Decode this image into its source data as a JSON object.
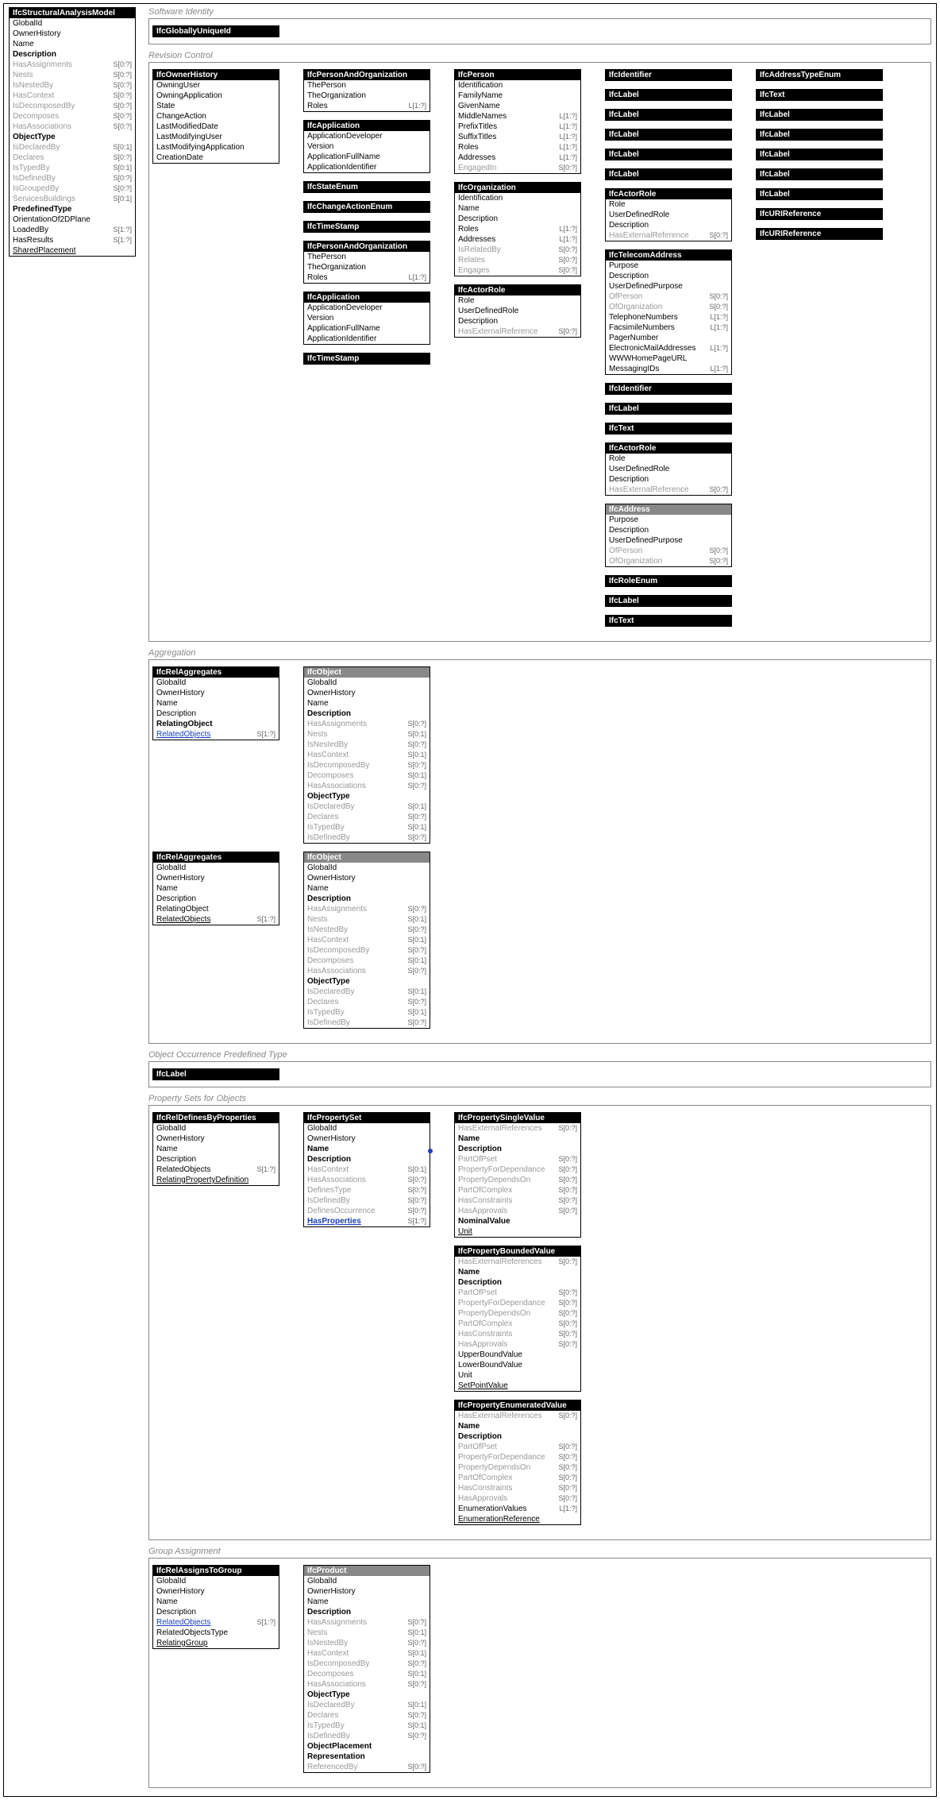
{
  "root": {
    "title": "IfcStructuralAnalysisModel",
    "attrs": [
      {
        "n": "GlobalId",
        "b": 0
      },
      {
        "n": "OwnerHistory",
        "b": 0
      },
      {
        "n": "Name",
        "b": 0
      },
      {
        "n": "Description",
        "b": 1
      },
      {
        "n": "HasAssignments",
        "c": "S[0:?]",
        "g": 1
      },
      {
        "n": "Nests",
        "c": "S[0:?]",
        "g": 1
      },
      {
        "n": "IsNestedBy",
        "c": "S[0:?]",
        "g": 1
      },
      {
        "n": "HasContext",
        "c": "S[0:?]",
        "g": 1
      },
      {
        "n": "IsDecomposedBy",
        "c": "S[0:?]",
        "g": 1
      },
      {
        "n": "Decomposes",
        "c": "S[0:?]",
        "g": 1
      },
      {
        "n": "HasAssociations",
        "c": "S[0:?]",
        "g": 1
      },
      {
        "n": "ObjectType",
        "b": 1
      },
      {
        "n": "IsDeclaredBy",
        "c": "S[0:1]",
        "g": 1
      },
      {
        "n": "Declares",
        "c": "S[0:?]",
        "g": 1
      },
      {
        "n": "IsTypedBy",
        "c": "S[0:1]",
        "g": 1
      },
      {
        "n": "IsDefinedBy",
        "c": "S[0:?]",
        "g": 1
      },
      {
        "n": "IsGroupedBy",
        "c": "S[0:?]",
        "g": 1
      },
      {
        "n": "ServicesBuildings",
        "c": "S[0:1]",
        "g": 1
      },
      {
        "n": "PredefinedType",
        "b": 1
      },
      {
        "n": "OrientationOf2DPlane",
        "b": 0
      },
      {
        "n": "LoadedBy",
        "c": "S[1:?]",
        "b": 0
      },
      {
        "n": "HasResults",
        "c": "S[1:?]",
        "b": 0
      },
      {
        "n": "SharedPlacement",
        "b": 0,
        "u": 1
      }
    ]
  },
  "sections": {
    "si": {
      "label": "Software Identity",
      "single": "IfcGloballyUniqueId"
    },
    "rc": {
      "label": "Revision Control"
    },
    "agg": {
      "label": "Aggregation"
    },
    "oopt": {
      "label": "Object Occurrence Predefined Type",
      "single": "IfcLabel"
    },
    "pso": {
      "label": "Property Sets for Objects"
    },
    "ga": {
      "label": "Group Assignment"
    }
  },
  "rc": {
    "ownerHistory": {
      "title": "IfcOwnerHistory",
      "attrs": [
        {
          "n": "OwningUser"
        },
        {
          "n": "OwningApplication"
        },
        {
          "n": "State"
        },
        {
          "n": "ChangeAction"
        },
        {
          "n": "LastModifiedDate"
        },
        {
          "n": "LastModifyingUser"
        },
        {
          "n": "LastModifyingApplication"
        },
        {
          "n": "CreationDate"
        }
      ]
    },
    "col2": [
      {
        "title": "IfcPersonAndOrganization",
        "attrs": [
          {
            "n": "ThePerson"
          },
          {
            "n": "TheOrganization"
          },
          {
            "n": "Roles",
            "c": "L[1:?]"
          }
        ]
      },
      {
        "title": "IfcApplication",
        "attrs": [
          {
            "n": "ApplicationDeveloper"
          },
          {
            "n": "Version"
          },
          {
            "n": "ApplicationFullName"
          },
          {
            "n": "ApplicationIdentifier"
          }
        ]
      },
      {
        "title": "IfcStateEnum",
        "attrs": []
      },
      {
        "title": "IfcChangeActionEnum",
        "attrs": []
      },
      {
        "title": "IfcTimeStamp",
        "attrs": []
      },
      {
        "title": "IfcPersonAndOrganization",
        "attrs": [
          {
            "n": "ThePerson"
          },
          {
            "n": "TheOrganization"
          },
          {
            "n": "Roles",
            "c": "L[1:?]"
          }
        ]
      },
      {
        "title": "IfcApplication",
        "attrs": [
          {
            "n": "ApplicationDeveloper"
          },
          {
            "n": "Version"
          },
          {
            "n": "ApplicationFullName"
          },
          {
            "n": "ApplicationIdentifier"
          }
        ]
      },
      {
        "title": "IfcTimeStamp",
        "attrs": []
      }
    ],
    "col3": [
      {
        "title": "IfcPerson",
        "attrs": [
          {
            "n": "Identification"
          },
          {
            "n": "FamilyName"
          },
          {
            "n": "GivenName"
          },
          {
            "n": "MiddleNames",
            "c": "L[1:?]"
          },
          {
            "n": "PrefixTitles",
            "c": "L[1:?]"
          },
          {
            "n": "SuffixTitles",
            "c": "L[1:?]"
          },
          {
            "n": "Roles",
            "c": "L[1:?]"
          },
          {
            "n": "Addresses",
            "c": "L[1:?]"
          },
          {
            "n": "EngagedIn",
            "c": "S[0:?]",
            "g": 1
          }
        ]
      },
      {
        "title": "IfcOrganization",
        "attrs": [
          {
            "n": "Identification"
          },
          {
            "n": "Name"
          },
          {
            "n": "Description"
          },
          {
            "n": "Roles",
            "c": "L[1:?]"
          },
          {
            "n": "Addresses",
            "c": "L[1:?]"
          },
          {
            "n": "IsRelatedBy",
            "c": "S[0:?]",
            "g": 1
          },
          {
            "n": "Relates",
            "c": "S[0:?]",
            "g": 1
          },
          {
            "n": "Engages",
            "c": "S[0:?]",
            "g": 1
          }
        ]
      },
      {
        "title": "IfcActorRole",
        "attrs": [
          {
            "n": "Role"
          },
          {
            "n": "UserDefinedRole"
          },
          {
            "n": "Description"
          },
          {
            "n": "HasExternalReference",
            "c": "S[0:?]",
            "g": 1
          }
        ]
      }
    ],
    "col4": [
      {
        "title": "IfcIdentifier",
        "attrs": []
      },
      {
        "title": "IfcLabel",
        "attrs": []
      },
      {
        "title": "IfcLabel",
        "attrs": []
      },
      {
        "title": "IfcLabel",
        "attrs": []
      },
      {
        "title": "IfcLabel",
        "attrs": []
      },
      {
        "title": "IfcLabel",
        "attrs": []
      },
      {
        "title": "IfcActorRole",
        "attrs": [
          {
            "n": "Role"
          },
          {
            "n": "UserDefinedRole"
          },
          {
            "n": "Description"
          },
          {
            "n": "HasExternalReference",
            "c": "S[0:?]",
            "g": 1
          }
        ]
      },
      {
        "title": "IfcTelecomAddress",
        "attrs": [
          {
            "n": "Purpose"
          },
          {
            "n": "Description"
          },
          {
            "n": "UserDefinedPurpose"
          },
          {
            "n": "OfPerson",
            "c": "S[0:?]",
            "g": 1
          },
          {
            "n": "OfOrganization",
            "c": "S[0:?]",
            "g": 1
          },
          {
            "n": "TelephoneNumbers",
            "c": "L[1:?]"
          },
          {
            "n": "FacsimileNumbers",
            "c": "L[1:?]"
          },
          {
            "n": "PagerNumber"
          },
          {
            "n": "ElectronicMailAddresses",
            "c": "L[1:?]"
          },
          {
            "n": "WWWHomePageURL"
          },
          {
            "n": "MessagingIDs",
            "c": "L[1:?]"
          }
        ]
      },
      {
        "title": "IfcIdentifier",
        "attrs": []
      },
      {
        "title": "IfcLabel",
        "attrs": []
      },
      {
        "title": "IfcText",
        "attrs": []
      },
      {
        "title": "IfcActorRole",
        "attrs": [
          {
            "n": "Role"
          },
          {
            "n": "UserDefinedRole"
          },
          {
            "n": "Description"
          },
          {
            "n": "HasExternalReference",
            "c": "S[0:?]",
            "g": 1
          }
        ]
      },
      {
        "title": "IfcAddress",
        "abstract": true,
        "attrs": [
          {
            "n": "Purpose"
          },
          {
            "n": "Description"
          },
          {
            "n": "UserDefinedPurpose"
          },
          {
            "n": "OfPerson",
            "c": "S[0:?]",
            "g": 1
          },
          {
            "n": "OfOrganization",
            "c": "S[0:?]",
            "g": 1
          }
        ]
      },
      {
        "title": "IfcRoleEnum",
        "attrs": []
      },
      {
        "title": "IfcLabel",
        "attrs": []
      },
      {
        "title": "IfcText",
        "attrs": []
      }
    ],
    "col5": [
      {
        "title": "IfcAddressTypeEnum",
        "attrs": []
      },
      {
        "title": "IfcText",
        "attrs": []
      },
      {
        "title": "IfcLabel",
        "attrs": []
      },
      {
        "title": "IfcLabel",
        "attrs": []
      },
      {
        "title": "IfcLabel",
        "attrs": []
      },
      {
        "title": "IfcLabel",
        "attrs": []
      },
      {
        "title": "IfcLabel",
        "attrs": []
      },
      {
        "title": "IfcURIReference",
        "attrs": []
      },
      {
        "title": "IfcURIReference",
        "attrs": []
      }
    ]
  },
  "agg": {
    "relAggregates": {
      "title": "IfcRelAggregates",
      "attrs": [
        {
          "n": "GlobalId"
        },
        {
          "n": "OwnerHistory"
        },
        {
          "n": "Name"
        },
        {
          "n": "Description"
        },
        {
          "n": "RelatingObject",
          "b": 1
        },
        {
          "n": "RelatedObjects",
          "c": "S[1:?]",
          "link": 1
        }
      ]
    },
    "relAggregates2": {
      "title": "IfcRelAggregates",
      "attrs": [
        {
          "n": "GlobalId"
        },
        {
          "n": "OwnerHistory"
        },
        {
          "n": "Name"
        },
        {
          "n": "Description"
        },
        {
          "n": "RelatingObject"
        },
        {
          "n": "RelatedObjects",
          "c": "S[1:?]",
          "u": 1
        }
      ]
    },
    "ifcObject": {
      "title": "IfcObject",
      "abstract": true,
      "attrs": [
        {
          "n": "GlobalId"
        },
        {
          "n": "OwnerHistory"
        },
        {
          "n": "Name"
        },
        {
          "n": "Description",
          "b": 1
        },
        {
          "n": "HasAssignments",
          "c": "S[0:?]",
          "g": 1
        },
        {
          "n": "Nests",
          "c": "S[0:1]",
          "g": 1
        },
        {
          "n": "IsNestedBy",
          "c": "S[0:?]",
          "g": 1
        },
        {
          "n": "HasContext",
          "c": "S[0:1]",
          "g": 1
        },
        {
          "n": "IsDecomposedBy",
          "c": "S[0:?]",
          "g": 1
        },
        {
          "n": "Decomposes",
          "c": "S[0:1]",
          "g": 1
        },
        {
          "n": "HasAssociations",
          "c": "S[0:?]",
          "g": 1
        },
        {
          "n": "ObjectType",
          "b": 1
        },
        {
          "n": "IsDeclaredBy",
          "c": "S[0:1]",
          "g": 1
        },
        {
          "n": "Declares",
          "c": "S[0:?]",
          "g": 1
        },
        {
          "n": "IsTypedBy",
          "c": "S[0:1]",
          "g": 1
        },
        {
          "n": "IsDefinedBy",
          "c": "S[0:?]",
          "g": 1
        }
      ]
    }
  },
  "pso": {
    "relDefines": {
      "title": "IfcRelDefinesByProperties",
      "attrs": [
        {
          "n": "GlobalId"
        },
        {
          "n": "OwnerHistory"
        },
        {
          "n": "Name"
        },
        {
          "n": "Description"
        },
        {
          "n": "RelatedObjects",
          "c": "S[1:?]"
        },
        {
          "n": "RelatingPropertyDefinition",
          "u": 1
        }
      ]
    },
    "propertySet": {
      "title": "IfcPropertySet",
      "attrs": [
        {
          "n": "GlobalId"
        },
        {
          "n": "OwnerHistory"
        },
        {
          "n": "Name",
          "b": 1,
          "dot": 1
        },
        {
          "n": "Description",
          "b": 1
        },
        {
          "n": "HasContext",
          "c": "S[0:1]",
          "g": 1
        },
        {
          "n": "HasAssociations",
          "c": "S[0:?]",
          "g": 1
        },
        {
          "n": "DefinesType",
          "c": "S[0:?]",
          "g": 1
        },
        {
          "n": "IsDefinedBy",
          "c": "S[0:?]",
          "g": 1
        },
        {
          "n": "DefinesOccurrence",
          "c": "S[0:?]",
          "g": 1
        },
        {
          "n": "HasProperties",
          "c": "S[1:?]",
          "link": 1,
          "b": 1
        }
      ]
    },
    "col3": [
      {
        "title": "IfcPropertySingleValue",
        "attrs": [
          {
            "n": "HasExternalReferences",
            "c": "S[0:?]",
            "g": 1
          },
          {
            "n": "Name",
            "b": 1
          },
          {
            "n": "Description",
            "b": 1
          },
          {
            "n": "PartOfPset",
            "c": "S[0:?]",
            "g": 1
          },
          {
            "n": "PropertyForDependance",
            "c": "S[0:?]",
            "g": 1
          },
          {
            "n": "PropertyDependsOn",
            "c": "S[0:?]",
            "g": 1
          },
          {
            "n": "PartOfComplex",
            "c": "S[0:?]",
            "g": 1
          },
          {
            "n": "HasConstraints",
            "c": "S[0:?]",
            "g": 1
          },
          {
            "n": "HasApprovals",
            "c": "S[0:?]",
            "g": 1
          },
          {
            "n": "NominalValue",
            "b": 1
          },
          {
            "n": "Unit",
            "u": 1
          }
        ]
      },
      {
        "title": "IfcPropertyBoundedValue",
        "attrs": [
          {
            "n": "HasExternalReferences",
            "c": "S[0:?]",
            "g": 1
          },
          {
            "n": "Name",
            "b": 1
          },
          {
            "n": "Description",
            "b": 1
          },
          {
            "n": "PartOfPset",
            "c": "S[0:?]",
            "g": 1
          },
          {
            "n": "PropertyForDependance",
            "c": "S[0:?]",
            "g": 1
          },
          {
            "n": "PropertyDependsOn",
            "c": "S[0:?]",
            "g": 1
          },
          {
            "n": "PartOfComplex",
            "c": "S[0:?]",
            "g": 1
          },
          {
            "n": "HasConstraints",
            "c": "S[0:?]",
            "g": 1
          },
          {
            "n": "HasApprovals",
            "c": "S[0:?]",
            "g": 1
          },
          {
            "n": "UpperBoundValue"
          },
          {
            "n": "LowerBoundValue"
          },
          {
            "n": "Unit"
          },
          {
            "n": "SetPointValue",
            "u": 1
          }
        ]
      },
      {
        "title": "IfcPropertyEnumeratedValue",
        "attrs": [
          {
            "n": "HasExternalReferences",
            "c": "S[0:?]",
            "g": 1
          },
          {
            "n": "Name",
            "b": 1
          },
          {
            "n": "Description",
            "b": 1
          },
          {
            "n": "PartOfPset",
            "c": "S[0:?]",
            "g": 1
          },
          {
            "n": "PropertyForDependance",
            "c": "S[0:?]",
            "g": 1
          },
          {
            "n": "PropertyDependsOn",
            "c": "S[0:?]",
            "g": 1
          },
          {
            "n": "PartOfComplex",
            "c": "S[0:?]",
            "g": 1
          },
          {
            "n": "HasConstraints",
            "c": "S[0:?]",
            "g": 1
          },
          {
            "n": "HasApprovals",
            "c": "S[0:?]",
            "g": 1
          },
          {
            "n": "EnumerationValues",
            "c": "L[1:?]"
          },
          {
            "n": "EnumerationReference",
            "u": 1
          }
        ]
      }
    ]
  },
  "ga": {
    "relAssigns": {
      "title": "IfcRelAssignsToGroup",
      "attrs": [
        {
          "n": "GlobalId"
        },
        {
          "n": "OwnerHistory"
        },
        {
          "n": "Name"
        },
        {
          "n": "Description"
        },
        {
          "n": "RelatedObjects",
          "c": "S[1:?]",
          "link": 1
        },
        {
          "n": "RelatedObjectsType"
        },
        {
          "n": "RelatingGroup",
          "u": 1
        }
      ]
    },
    "product": {
      "title": "IfcProduct",
      "abstract": true,
      "attrs": [
        {
          "n": "GlobalId"
        },
        {
          "n": "OwnerHistory"
        },
        {
          "n": "Name"
        },
        {
          "n": "Description",
          "b": 1
        },
        {
          "n": "HasAssignments",
          "c": "S[0:?]",
          "g": 1
        },
        {
          "n": "Nests",
          "c": "S[0:1]",
          "g": 1
        },
        {
          "n": "IsNestedBy",
          "c": "S[0:?]",
          "g": 1
        },
        {
          "n": "HasContext",
          "c": "S[0:1]",
          "g": 1
        },
        {
          "n": "IsDecomposedBy",
          "c": "S[0:?]",
          "g": 1
        },
        {
          "n": "Decomposes",
          "c": "S[0:1]",
          "g": 1
        },
        {
          "n": "HasAssociations",
          "c": "S[0:?]",
          "g": 1
        },
        {
          "n": "ObjectType",
          "b": 1
        },
        {
          "n": "IsDeclaredBy",
          "c": "S[0:1]",
          "g": 1
        },
        {
          "n": "Declares",
          "c": "S[0:?]",
          "g": 1
        },
        {
          "n": "IsTypedBy",
          "c": "S[0:1]",
          "g": 1
        },
        {
          "n": "IsDefinedBy",
          "c": "S[0:?]",
          "g": 1
        },
        {
          "n": "ObjectPlacement",
          "b": 1
        },
        {
          "n": "Representation",
          "b": 1
        },
        {
          "n": "ReferencedBy",
          "c": "S[0:?]",
          "g": 1
        }
      ]
    }
  }
}
